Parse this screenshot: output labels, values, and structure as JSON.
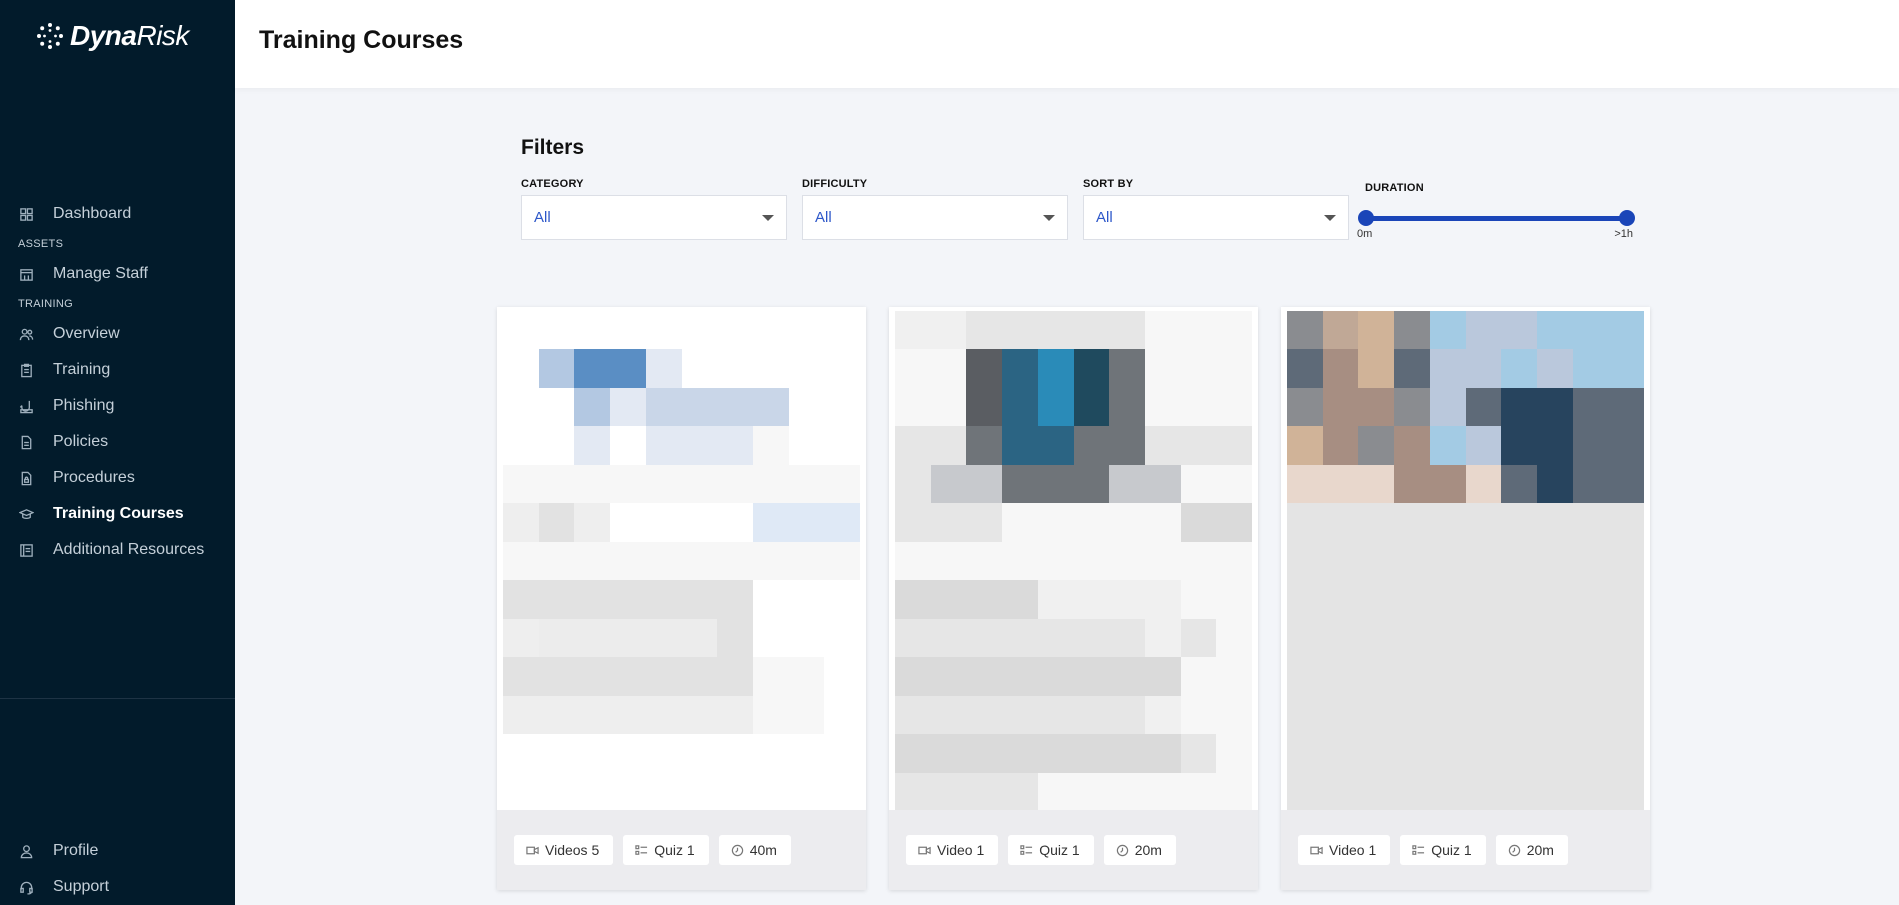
{
  "app": {
    "logo_bold": "Dyna",
    "logo_light": "Risk"
  },
  "sidebar": {
    "items": [
      {
        "label": "Dashboard",
        "icon": "dashboard-icon"
      },
      {
        "section": "ASSETS"
      },
      {
        "label": "Manage Staff",
        "icon": "building-icon"
      },
      {
        "section": "TRAINING"
      },
      {
        "label": "Overview",
        "icon": "users-icon"
      },
      {
        "label": "Training",
        "icon": "clipboard-icon"
      },
      {
        "label": "Phishing",
        "icon": "hook-icon"
      },
      {
        "label": "Policies",
        "icon": "document-icon"
      },
      {
        "label": "Procedures",
        "icon": "document-lock-icon"
      },
      {
        "label": "Training Courses",
        "icon": "graduation-cap-icon",
        "active": true
      },
      {
        "label": "Additional Resources",
        "icon": "book-icon"
      }
    ],
    "bottom": [
      {
        "label": "Profile",
        "icon": "user-icon"
      },
      {
        "label": "Support",
        "icon": "headset-icon"
      }
    ]
  },
  "header": {
    "title": "Training Courses"
  },
  "filters": {
    "title": "Filters",
    "category": {
      "label": "CATEGORY",
      "value": "All"
    },
    "difficulty": {
      "label": "DIFFICULTY",
      "value": "All"
    },
    "sort_by": {
      "label": "SORT BY",
      "value": "All"
    },
    "duration": {
      "label": "DURATION",
      "min_label": "0m",
      "max_label": ">1h"
    }
  },
  "colors": {
    "sidebar_bg": "#021b2b",
    "accent": "#1a45b8",
    "select_text": "#2d57c9"
  },
  "cards": [
    {
      "chips": [
        {
          "icon": "video-icon",
          "label": "Videos 5"
        },
        {
          "icon": "quiz-icon",
          "label": "Quiz 1"
        },
        {
          "icon": "clock-icon",
          "label": "40m"
        }
      ]
    },
    {
      "chips": [
        {
          "icon": "video-icon",
          "label": "Video 1"
        },
        {
          "icon": "quiz-icon",
          "label": "Quiz 1"
        },
        {
          "icon": "clock-icon",
          "label": "20m"
        }
      ]
    },
    {
      "chips": [
        {
          "icon": "video-icon",
          "label": "Video 1"
        },
        {
          "icon": "quiz-icon",
          "label": "Quiz 1"
        },
        {
          "icon": "clock-icon",
          "label": "20m"
        }
      ]
    }
  ]
}
